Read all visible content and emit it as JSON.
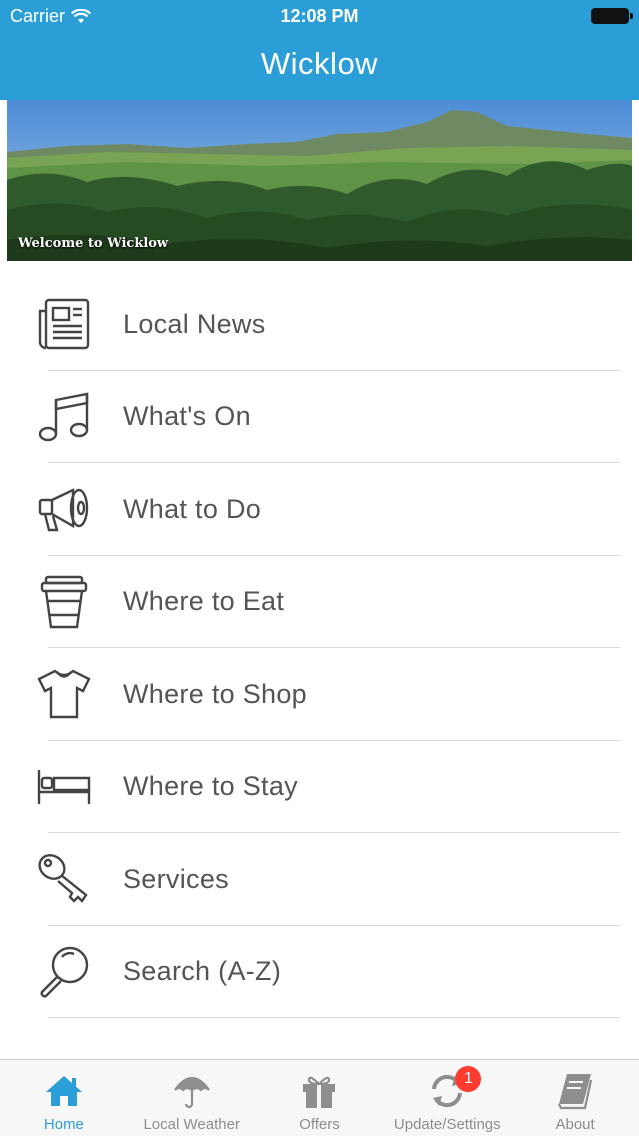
{
  "status_bar": {
    "carrier": "Carrier",
    "time": "12:08 PM"
  },
  "header": {
    "title": "Wicklow"
  },
  "banner": {
    "caption": "Welcome to Wicklow"
  },
  "menu": [
    {
      "label": "Local News",
      "icon": "newspaper-icon"
    },
    {
      "label": "What's On",
      "icon": "music-note-icon"
    },
    {
      "label": "What to Do",
      "icon": "megaphone-icon"
    },
    {
      "label": "Where to Eat",
      "icon": "coffee-cup-icon"
    },
    {
      "label": "Where to Shop",
      "icon": "tshirt-icon"
    },
    {
      "label": "Where to Stay",
      "icon": "bed-icon"
    },
    {
      "label": "Services",
      "icon": "key-icon"
    },
    {
      "label": "Search (A-Z)",
      "icon": "magnifier-icon"
    }
  ],
  "tabbar": [
    {
      "label": "Home",
      "icon": "home-icon",
      "active": true
    },
    {
      "label": "Local Weather",
      "icon": "umbrella-icon"
    },
    {
      "label": "Offers",
      "icon": "gift-icon"
    },
    {
      "label": "Update/Settings",
      "icon": "refresh-icon",
      "badge": "1"
    },
    {
      "label": "About",
      "icon": "book-icon"
    }
  ],
  "colors": {
    "accent": "#2b9ed8",
    "menu_text": "#555555",
    "inactive_tab": "#8e8e8e",
    "badge": "#ff3b30"
  }
}
